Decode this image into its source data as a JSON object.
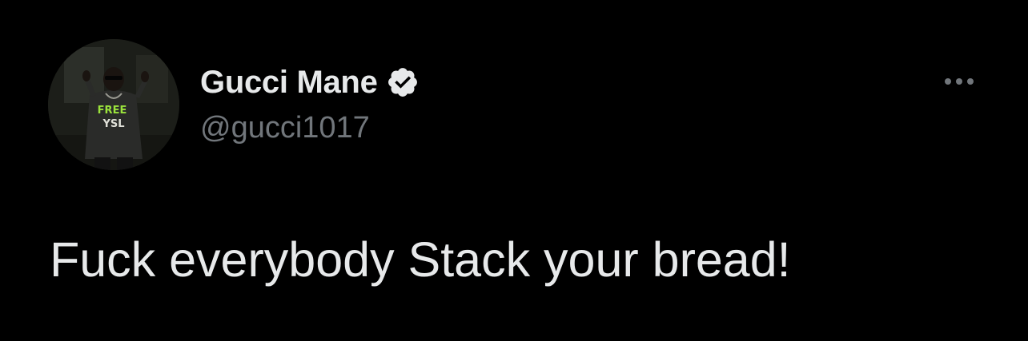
{
  "tweet": {
    "author": {
      "display_name": "Gucci Mane",
      "handle": "@gucci1017",
      "verified": true,
      "avatar_shirt_text": [
        "FREE",
        "YSL"
      ]
    },
    "text": "Fuck everybody Stack your bread!",
    "more_icon": "more-horizontal-icon"
  },
  "colors": {
    "background": "#000000",
    "primary_text": "#e7e9ea",
    "secondary_text": "#71767b",
    "verified_badge": "#e7e9ea",
    "avatar_shirt_text": "#9be33c"
  }
}
